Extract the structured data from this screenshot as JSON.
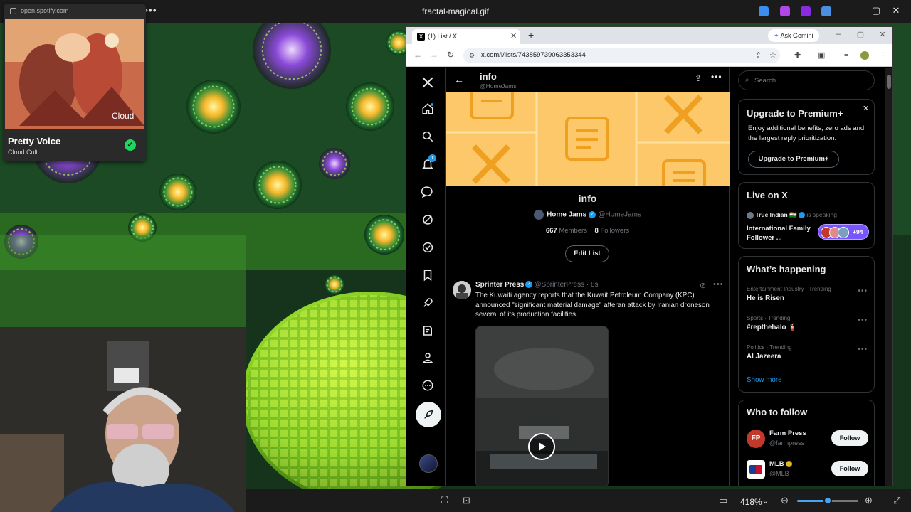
{
  "viewer": {
    "title": "fractal-magical.gif",
    "zoom": "418%",
    "zoom_slider_fraction": 0.5
  },
  "spotify": {
    "url": "open.spotify.com",
    "track": "Pretty Voice",
    "artist": "Cloud Cult",
    "saved_icon": "check-circle-icon"
  },
  "browser": {
    "tab_title": "(1) List / X",
    "url": "x.com/i/lists/743859739063353344",
    "gemini_label": "Ask Gemini"
  },
  "x": {
    "header": {
      "title": "info",
      "handle": "@HomeJams"
    },
    "list": {
      "name": "info",
      "owner_name": "Home Jams",
      "owner_handle": "@HomeJams",
      "members_count": "667",
      "members_label": "Members",
      "followers_count": "8",
      "followers_label": "Followers",
      "edit_label": "Edit List"
    },
    "tweet": {
      "name": "Sprinter Press",
      "handle": "@SprinterPress",
      "time": "· 8s",
      "text": "The Kuwaiti agency reports that the Kuwait Petroleum Company (KPC) announced \"significant material damage\" afteran attack by Iranian droneson several of its production facilities."
    },
    "search_placeholder": "Search",
    "premium": {
      "title": "Upgrade to Premium+",
      "text": "Enjoy additional benefits, zero ads and the largest reply prioritization.",
      "button": "Upgrade to Premium+"
    },
    "live": {
      "title": "Live on X",
      "host": "True Indian 🇮🇳",
      "status": "is speaking",
      "topic": "International Family Follower ...",
      "count": "+94"
    },
    "happening": {
      "title": "What’s happening",
      "trends": [
        {
          "meta": "Entertainment Industry · Trending",
          "name": "He is Risen"
        },
        {
          "meta": "Sports · Trending",
          "name": "#repthehalo 🧯"
        },
        {
          "meta": "Politics · Trending",
          "name": "Al Jazeera"
        }
      ],
      "show_more": "Show more"
    },
    "who_to_follow": {
      "title": "Who to follow",
      "accounts": [
        {
          "name": "Farm Press",
          "handle": "@farmpress",
          "button": "Follow",
          "initials": "FP"
        },
        {
          "name": "MLB",
          "handle": "@MLB",
          "button": "Follow",
          "initials": ""
        }
      ]
    },
    "notification_badge": "1"
  }
}
